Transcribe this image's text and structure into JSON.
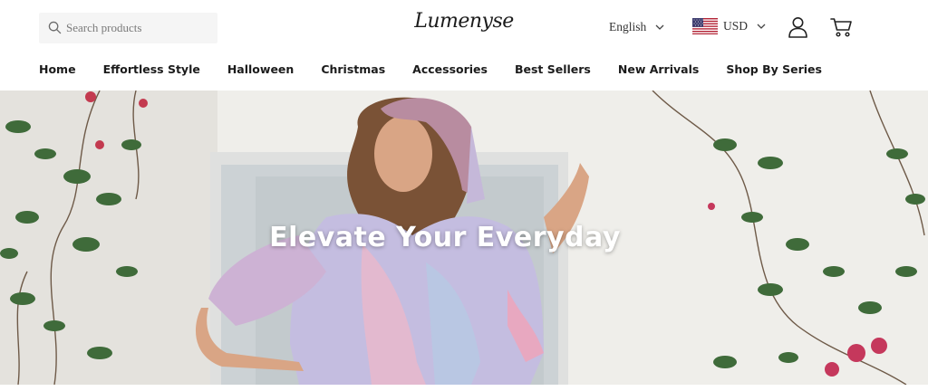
{
  "header": {
    "search_placeholder": "Search products",
    "logo_text": "Lumenyse",
    "language": "English",
    "currency": "USD",
    "icons": {
      "search": "search-icon",
      "language_chevron": "chevron-down-icon",
      "currency_chevron": "chevron-down-icon",
      "flag": "us-flag-icon",
      "account": "user-icon",
      "cart": "cart-icon"
    }
  },
  "nav": {
    "items": [
      "Home",
      "Effortless Style",
      "Halloween",
      "Christmas",
      "Accessories",
      "Best Sellers",
      "New Arrivals",
      "Shop By Series"
    ]
  },
  "hero": {
    "title": "Elevate Your Everyday"
  },
  "colors": {
    "text": "#1b1b1b",
    "search_bg": "#f5f5f5",
    "hero_wall": "#f2f1ee"
  }
}
